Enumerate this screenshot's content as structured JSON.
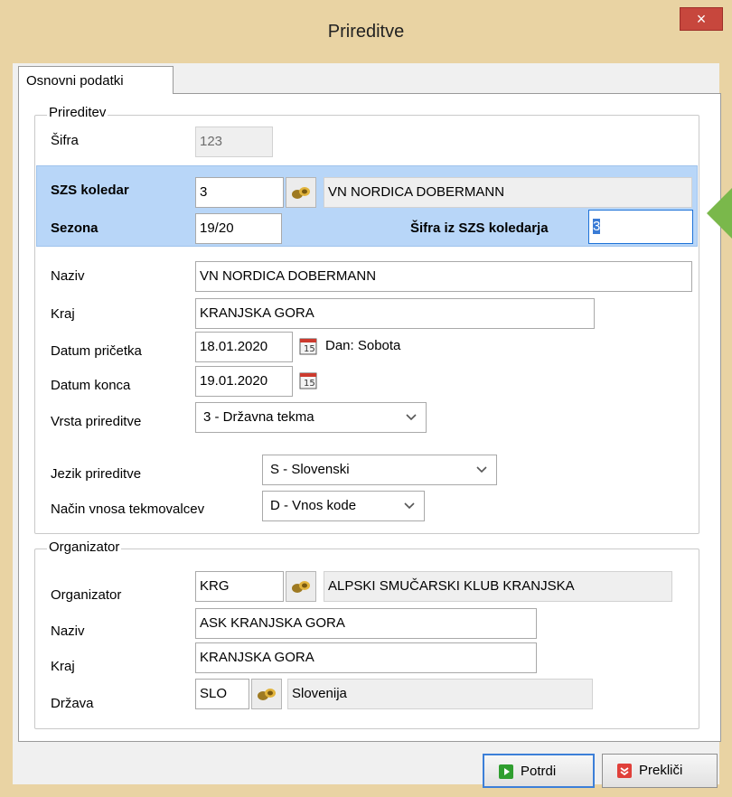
{
  "window": {
    "title": "Prireditve",
    "close_glyph": "×"
  },
  "tabs": [
    {
      "label": "Osnovni podatki"
    }
  ],
  "prireditev": {
    "group_label": "Prireditev",
    "sifra_label": "Šifra",
    "sifra_value": "123",
    "szs_koledar_label": "SZS koledar",
    "szs_koledar_value": "3",
    "szs_koledar_name": "VN NORDICA DOBERMANN",
    "sezona_label": "Sezona",
    "sezona_value": "19/20",
    "sifra_koledar_label": "Šifra iz SZS koledarja",
    "sifra_koledar_value": "3",
    "naziv_label": "Naziv",
    "naziv_value": "VN NORDICA DOBERMANN",
    "kraj_label": "Kraj",
    "kraj_value": "KRANJSKA GORA",
    "datum_zacetka_label": "Datum pričetka",
    "datum_zacetka_value": "18.01.2020",
    "dan_text": "Dan: Sobota",
    "datum_konca_label": "Datum konca",
    "datum_konca_value": "19.01.2020",
    "vrsta_label": "Vrsta prireditve",
    "vrsta_value": "3 - Državna tekma",
    "jezik_label": "Jezik prireditve",
    "jezik_value": "S - Slovenski",
    "nacin_label": "Način vnosa tekmovalcev",
    "nacin_value": "D - Vnos kode"
  },
  "organizator": {
    "group_label": "Organizator",
    "org_label": "Organizator",
    "org_code": "KRG",
    "org_name": "ALPSKI SMUČARSKI KLUB KRANJSKA",
    "naziv_label": "Naziv",
    "naziv_value": "ASK KRANJSKA GORA",
    "kraj_label": "Kraj",
    "kraj_value": "KRANJSKA GORA",
    "drzava_label": "Država",
    "drzava_code": "SLO",
    "drzava_name": "Slovenija"
  },
  "buttons": {
    "confirm": "Potrdi",
    "cancel": "Prekliči"
  },
  "colors": {
    "highlight": "#b8d6f8",
    "close": "#c7473d",
    "frame": "#e9d3a3",
    "confirm_icon": "#2f9e2f",
    "cancel_icon": "#e0403a"
  },
  "icons": {
    "lookup": "binoculars-icon",
    "calendar": "calendar-icon",
    "dropdown": "chevron-down-icon"
  }
}
